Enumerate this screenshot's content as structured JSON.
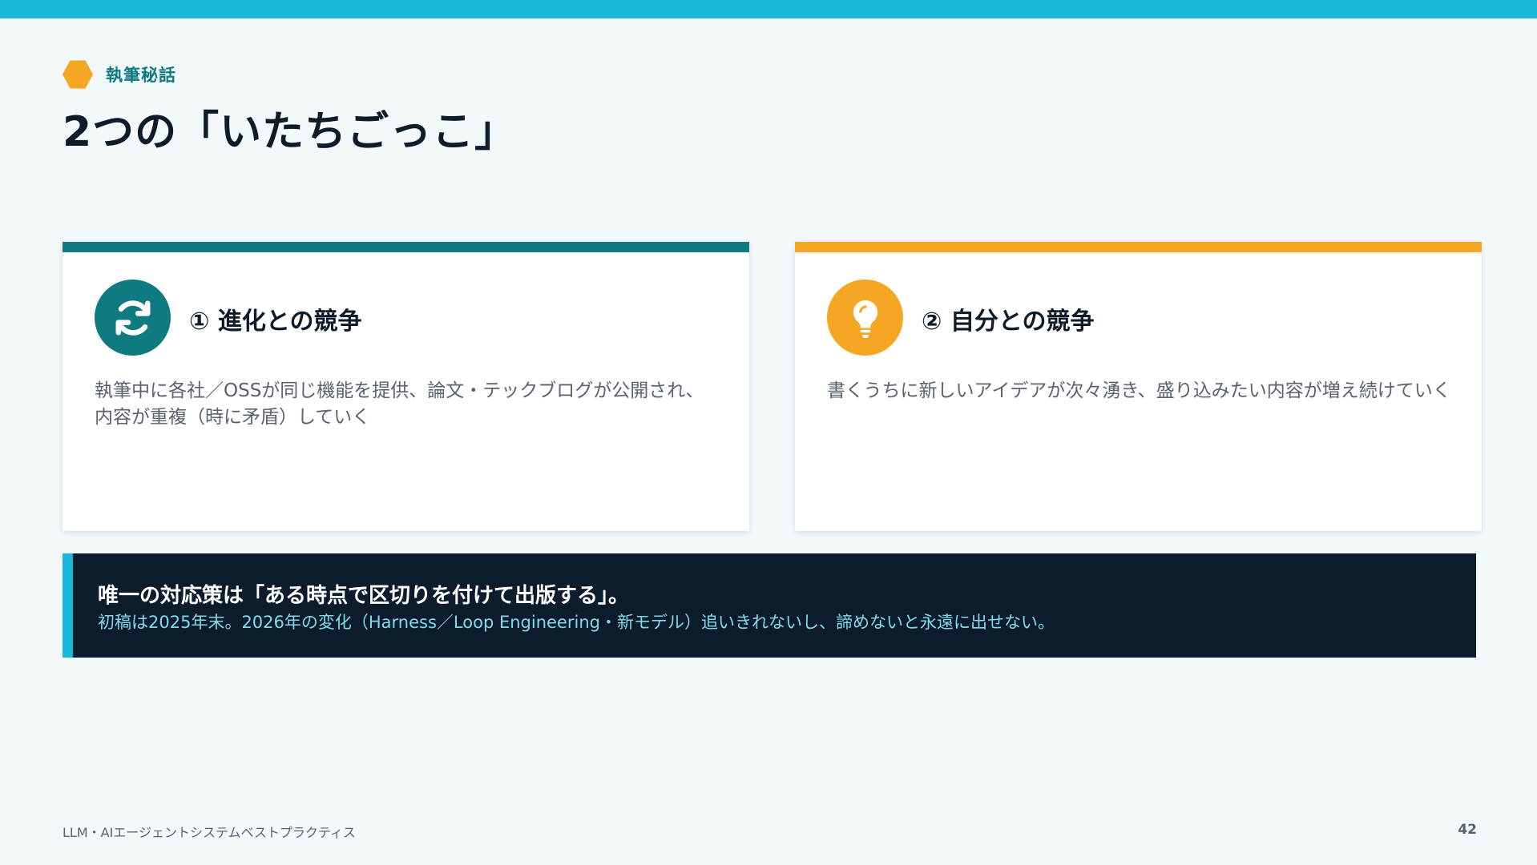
{
  "header": {
    "eyebrow": "執筆秘話",
    "title": "2つの「いたちごっこ」"
  },
  "cards": [
    {
      "heading": "① 進化との競争",
      "body": "執筆中に各社／OSSが同じ機能を提供、論文・テックブログが公開され、内容が重複（時に矛盾）していく",
      "icon": "refresh-icon"
    },
    {
      "heading": "② 自分との競争",
      "body": "書くうちに新しいアイデアが次々湧き、盛り込みたい内容が増え続けていく",
      "icon": "lightbulb-icon"
    }
  ],
  "callout": {
    "main": "唯一の対応策は「ある時点で区切りを付けて出版する」。",
    "sub": "初稿は2025年末。2026年の変化（Harness／Loop Engineering・新モデル）追いきれないし、諦めないと永遠に出せない。"
  },
  "footer": {
    "left": "LLM・AIエージェントシステムベストプラクティス",
    "page": "42"
  },
  "colors": {
    "accent_cyan": "#19b9d9",
    "teal": "#0f7a80",
    "orange": "#f5a623",
    "dark_navy": "#0c1c2c"
  }
}
